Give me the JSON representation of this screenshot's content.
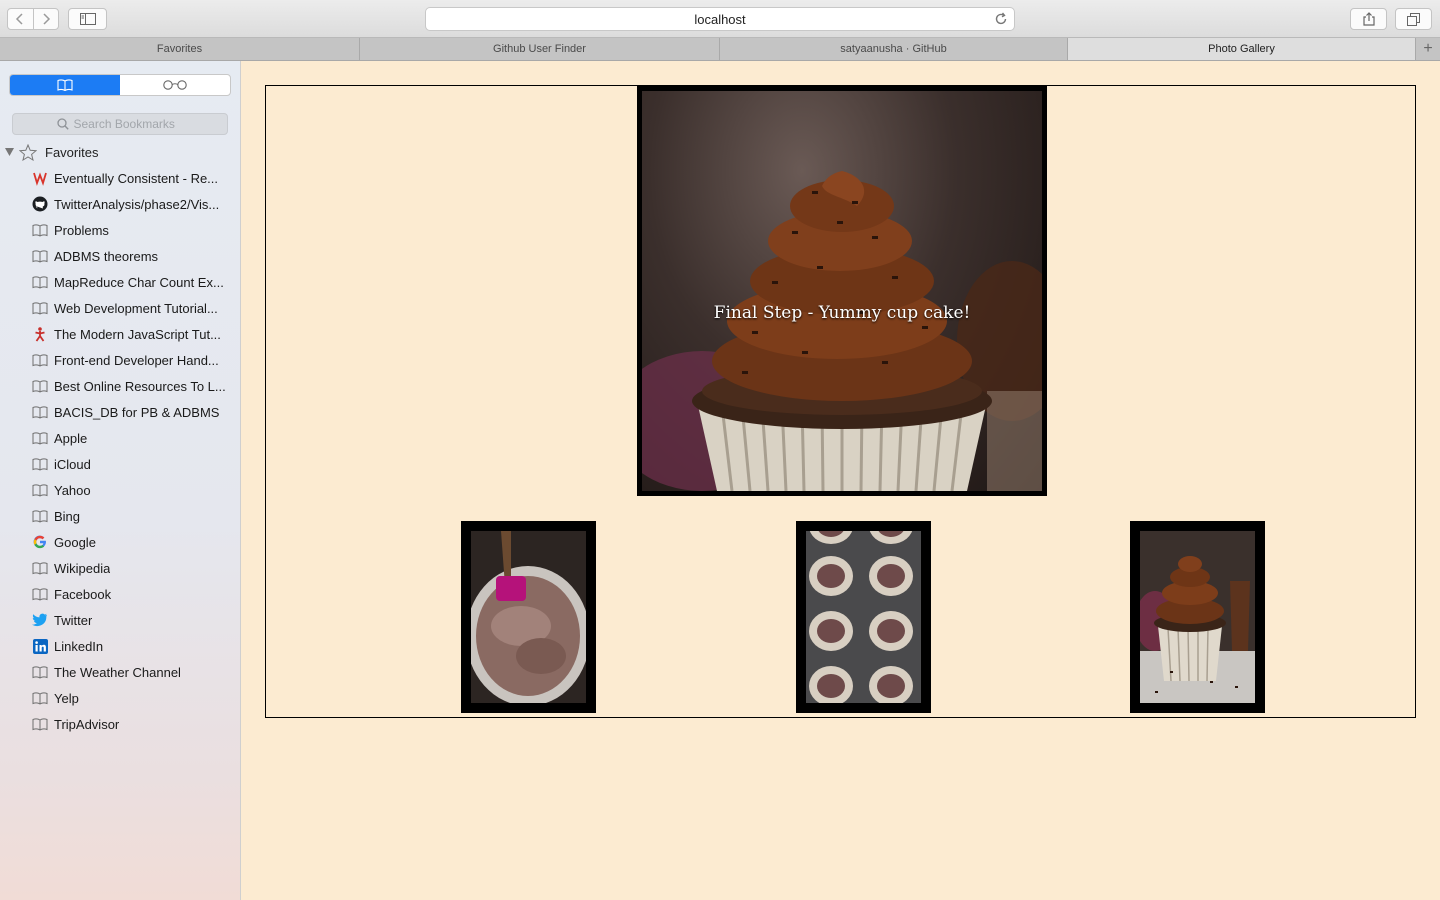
{
  "browser": {
    "address": "localhost",
    "tabs": [
      {
        "label": "Favorites",
        "active": false
      },
      {
        "label": "Github User Finder",
        "active": false
      },
      {
        "label": "satyaanusha · GitHub",
        "active": false
      },
      {
        "label": "Photo Gallery",
        "active": true
      }
    ],
    "new_tab_symbol": "+"
  },
  "sidebar": {
    "search_placeholder": "Search Bookmarks",
    "section_title": "Favorites",
    "items": [
      {
        "label": "Eventually Consistent - Re...",
        "icon": "wikipedia-w-icon"
      },
      {
        "label": "TwitterAnalysis/phase2/Vis...",
        "icon": "github-icon"
      },
      {
        "label": "Problems",
        "icon": "book-icon"
      },
      {
        "label": "ADBMS theorems",
        "icon": "book-icon"
      },
      {
        "label": "MapReduce Char Count Ex...",
        "icon": "book-icon"
      },
      {
        "label": "Web Development Tutorial...",
        "icon": "book-icon"
      },
      {
        "label": "The Modern JavaScript Tut...",
        "icon": "js-tutorial-icon"
      },
      {
        "label": "Front-end Developer Hand...",
        "icon": "book-icon"
      },
      {
        "label": "Best Online Resources To L...",
        "icon": "book-icon"
      },
      {
        "label": "BACIS_DB for PB & ADBMS",
        "icon": "book-icon"
      },
      {
        "label": "Apple",
        "icon": "book-icon"
      },
      {
        "label": "iCloud",
        "icon": "book-icon"
      },
      {
        "label": "Yahoo",
        "icon": "book-icon"
      },
      {
        "label": "Bing",
        "icon": "book-icon"
      },
      {
        "label": "Google",
        "icon": "google-icon"
      },
      {
        "label": "Wikipedia",
        "icon": "book-icon"
      },
      {
        "label": "Facebook",
        "icon": "book-icon"
      },
      {
        "label": "Twitter",
        "icon": "twitter-icon"
      },
      {
        "label": "LinkedIn",
        "icon": "linkedin-icon"
      },
      {
        "label": "The Weather Channel",
        "icon": "book-icon"
      },
      {
        "label": "Yelp",
        "icon": "book-icon"
      },
      {
        "label": "TripAdvisor",
        "icon": "book-icon"
      }
    ]
  },
  "gallery": {
    "main_caption": "Final Step - Yummy cup cake!"
  },
  "colors": {
    "page_background": "#fcebd1",
    "segment_active": "#1c7cf4",
    "frame": "#000000"
  }
}
